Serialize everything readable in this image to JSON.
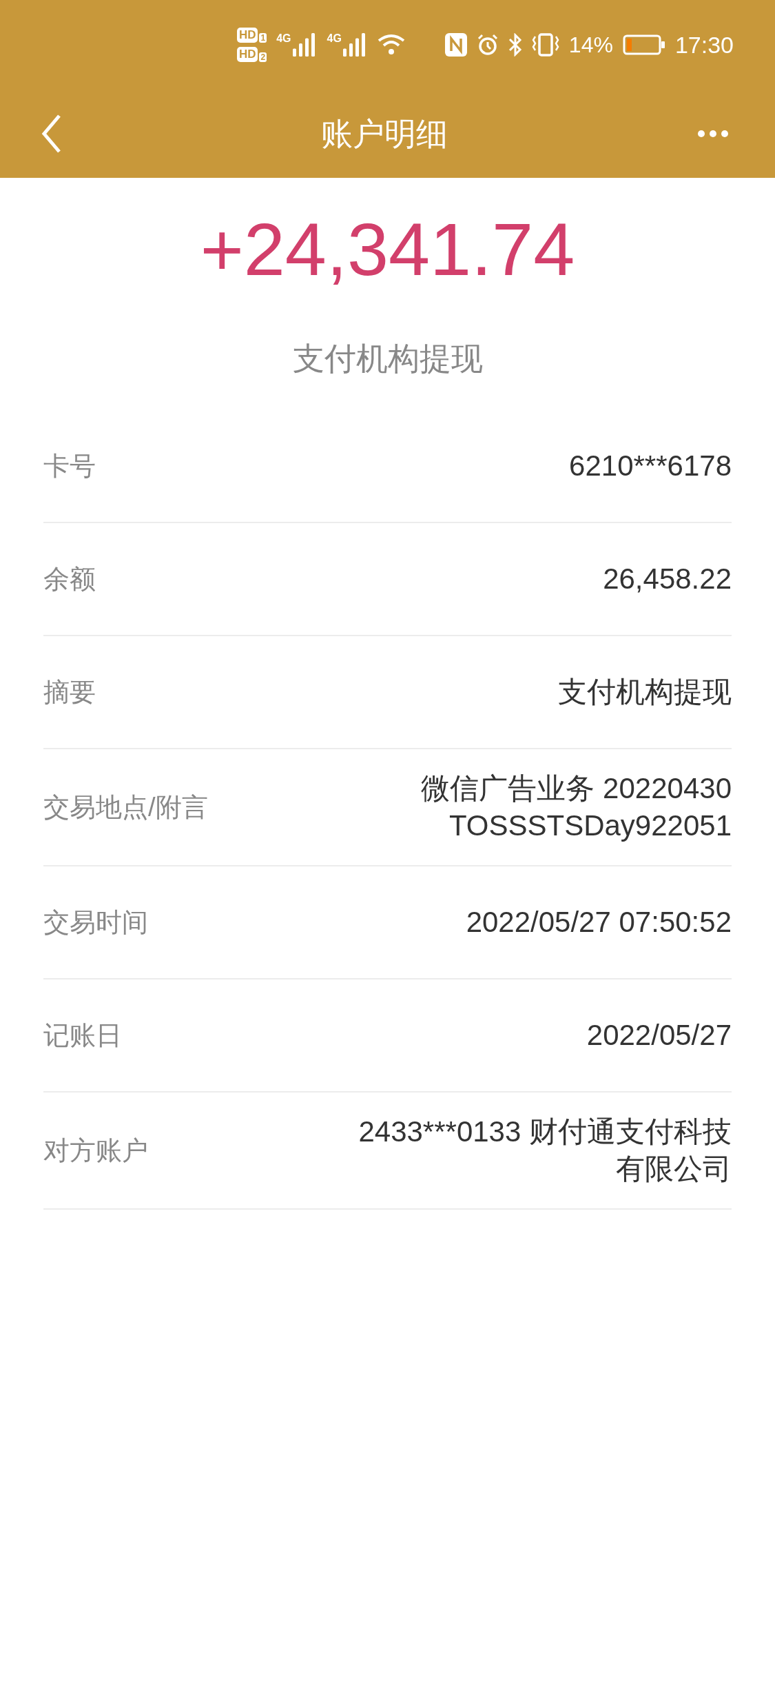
{
  "status_bar": {
    "sim_badges": [
      {
        "label": "HD",
        "slot": "1"
      },
      {
        "label": "HD",
        "slot": "2"
      }
    ],
    "networks": [
      "4G",
      "4G"
    ],
    "battery": "14%",
    "time": "17:30"
  },
  "header": {
    "title": "账户明细"
  },
  "amount": "+24,341.74",
  "summary": "支付机构提现",
  "details": [
    {
      "label": "卡号",
      "value": [
        "6210***6178"
      ]
    },
    {
      "label": "余额",
      "value": [
        "26,458.22"
      ]
    },
    {
      "label": "摘要",
      "value": [
        "支付机构提现"
      ]
    },
    {
      "label": "交易地点/附言",
      "value": [
        "微信广告业务 20220430",
        "TOSSSTSDay922051"
      ]
    },
    {
      "label": "交易时间",
      "value": [
        "2022/05/27 07:50:52"
      ]
    },
    {
      "label": "记账日",
      "value": [
        "2022/05/27"
      ]
    },
    {
      "label": "对方账户",
      "value": [
        "2433***0133 财付通支付科技",
        "有限公司"
      ]
    }
  ]
}
